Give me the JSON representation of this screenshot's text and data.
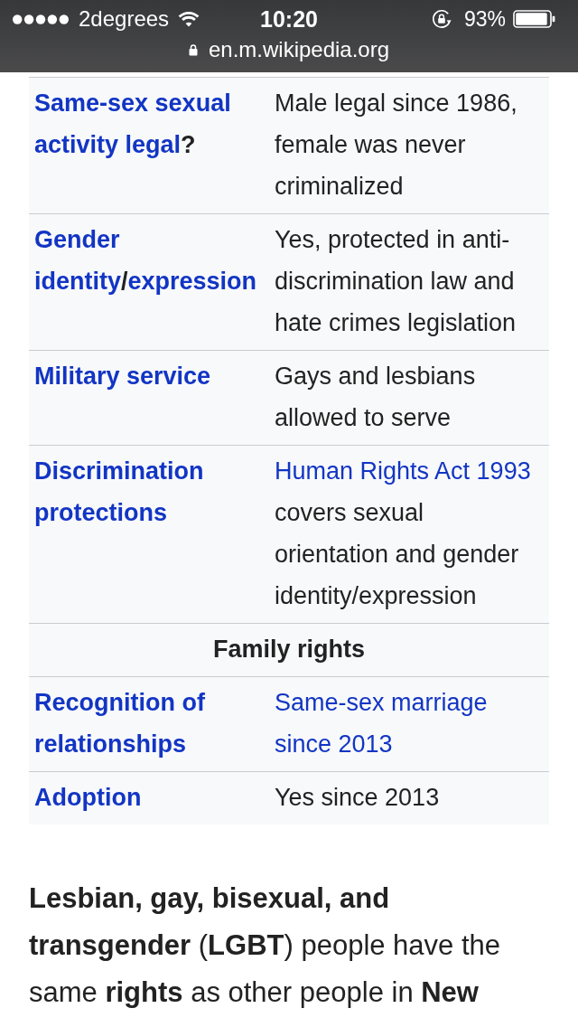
{
  "status_bar": {
    "carrier": "2degrees",
    "time": "10:20",
    "battery": "93%"
  },
  "address_bar": {
    "url": "en.m.wikipedia.org"
  },
  "infobox": {
    "rows": [
      {
        "kind": "row",
        "label": [
          {
            "kind": "link",
            "text": "Same-sex sexual activity legal"
          },
          {
            "kind": "text",
            "text": "?"
          }
        ],
        "value": [
          {
            "kind": "text",
            "text": "Male legal since 1986, female was never criminalized"
          }
        ]
      },
      {
        "kind": "row",
        "label": [
          {
            "kind": "link",
            "text": "Gender identity"
          },
          {
            "kind": "text",
            "text": "/"
          },
          {
            "kind": "link",
            "text": "expression"
          }
        ],
        "value": [
          {
            "kind": "text",
            "text": "Yes, protected in anti-discrimination law and hate crimes legislation"
          }
        ]
      },
      {
        "kind": "row",
        "label": [
          {
            "kind": "link",
            "text": "Military service"
          }
        ],
        "value": [
          {
            "kind": "text",
            "text": "Gays and lesbians allowed to serve"
          }
        ]
      },
      {
        "kind": "row",
        "label": [
          {
            "kind": "link",
            "text": "Discrimination protections"
          }
        ],
        "value": [
          {
            "kind": "link",
            "text": "Human Rights Act 1993"
          },
          {
            "kind": "text",
            "text": " covers sexual orientation and gender identity/expression"
          }
        ]
      },
      {
        "kind": "section",
        "title": "Family rights"
      },
      {
        "kind": "row",
        "label": [
          {
            "kind": "link",
            "text": "Recognition of relationships"
          }
        ],
        "value": [
          {
            "kind": "link",
            "text": "Same-sex marriage since 2013"
          }
        ]
      },
      {
        "kind": "row",
        "label": [
          {
            "kind": "link",
            "text": "Adoption"
          }
        ],
        "value": [
          {
            "kind": "text",
            "text": "Yes since 2013"
          }
        ]
      }
    ]
  },
  "article": {
    "paragraph": "**Lesbian, gay, bisexual, and transgender** (**LGBT**) people have the same **rights** as other people in **New**"
  }
}
